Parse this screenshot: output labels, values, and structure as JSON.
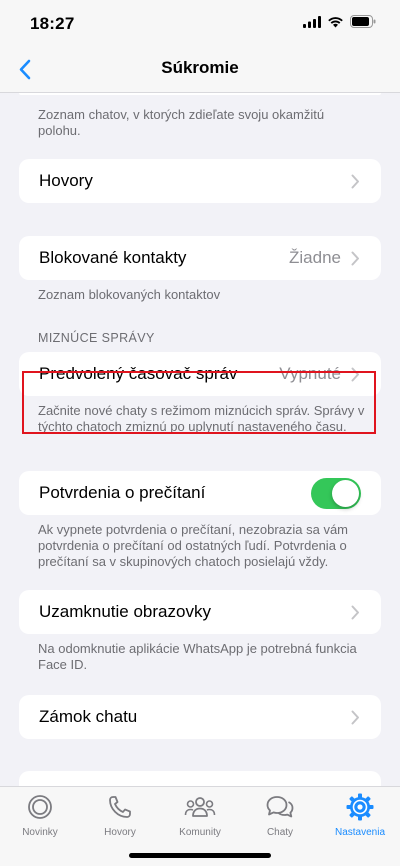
{
  "status_bar": {
    "time": "18:27",
    "icons": [
      "signal-icon",
      "wifi-icon",
      "battery-icon"
    ]
  },
  "nav": {
    "title": "Súkromie",
    "back_icon": "chevron-left-icon"
  },
  "live_location": {
    "footer": "Zoznam chatov, v ktorých zdieľate svoju okamžitú polohu."
  },
  "calls": {
    "label": "Hovory"
  },
  "blocked": {
    "label": "Blokované kontakty",
    "value": "Žiadne",
    "footer": "Zoznam blokovaných kontaktov"
  },
  "disappearing": {
    "header": "MIZNÚCE SPRÁVY",
    "label": "Predvolený časovač správ",
    "value": "Vypnuté",
    "footer": "Začnite nové chaty s režimom miznúcich správ. Správy v týchto chatoch zmiznú po uplynutí nastaveného času."
  },
  "read_receipts": {
    "label": "Potvrdenia o prečítaní",
    "enabled": true,
    "footer": "Ak vypnete potvrdenia o prečítaní, nezobrazia sa vám potvrdenia o prečítaní od ostatných ľudí. Potvrdenia o prečítaní sa v skupinových chatoch posielajú vždy."
  },
  "screen_lock": {
    "label": "Uzamknutie obrazovky",
    "footer": "Na odomknutie aplikácie WhatsApp je potrebná funkcia Face ID."
  },
  "chat_lock": {
    "label": "Zámok chatu"
  },
  "tabs": [
    {
      "label": "Novinky",
      "icon": "updates-icon",
      "active": false
    },
    {
      "label": "Hovory",
      "icon": "phone-icon",
      "active": false
    },
    {
      "label": "Komunity",
      "icon": "communities-icon",
      "active": false
    },
    {
      "label": "Chaty",
      "icon": "chats-icon",
      "active": false
    },
    {
      "label": "Nastavenia",
      "icon": "settings-gear-icon",
      "active": true
    }
  ],
  "colors": {
    "accent": "#1a8cff",
    "toggle_on": "#34c759",
    "highlight": "#e0141e"
  }
}
